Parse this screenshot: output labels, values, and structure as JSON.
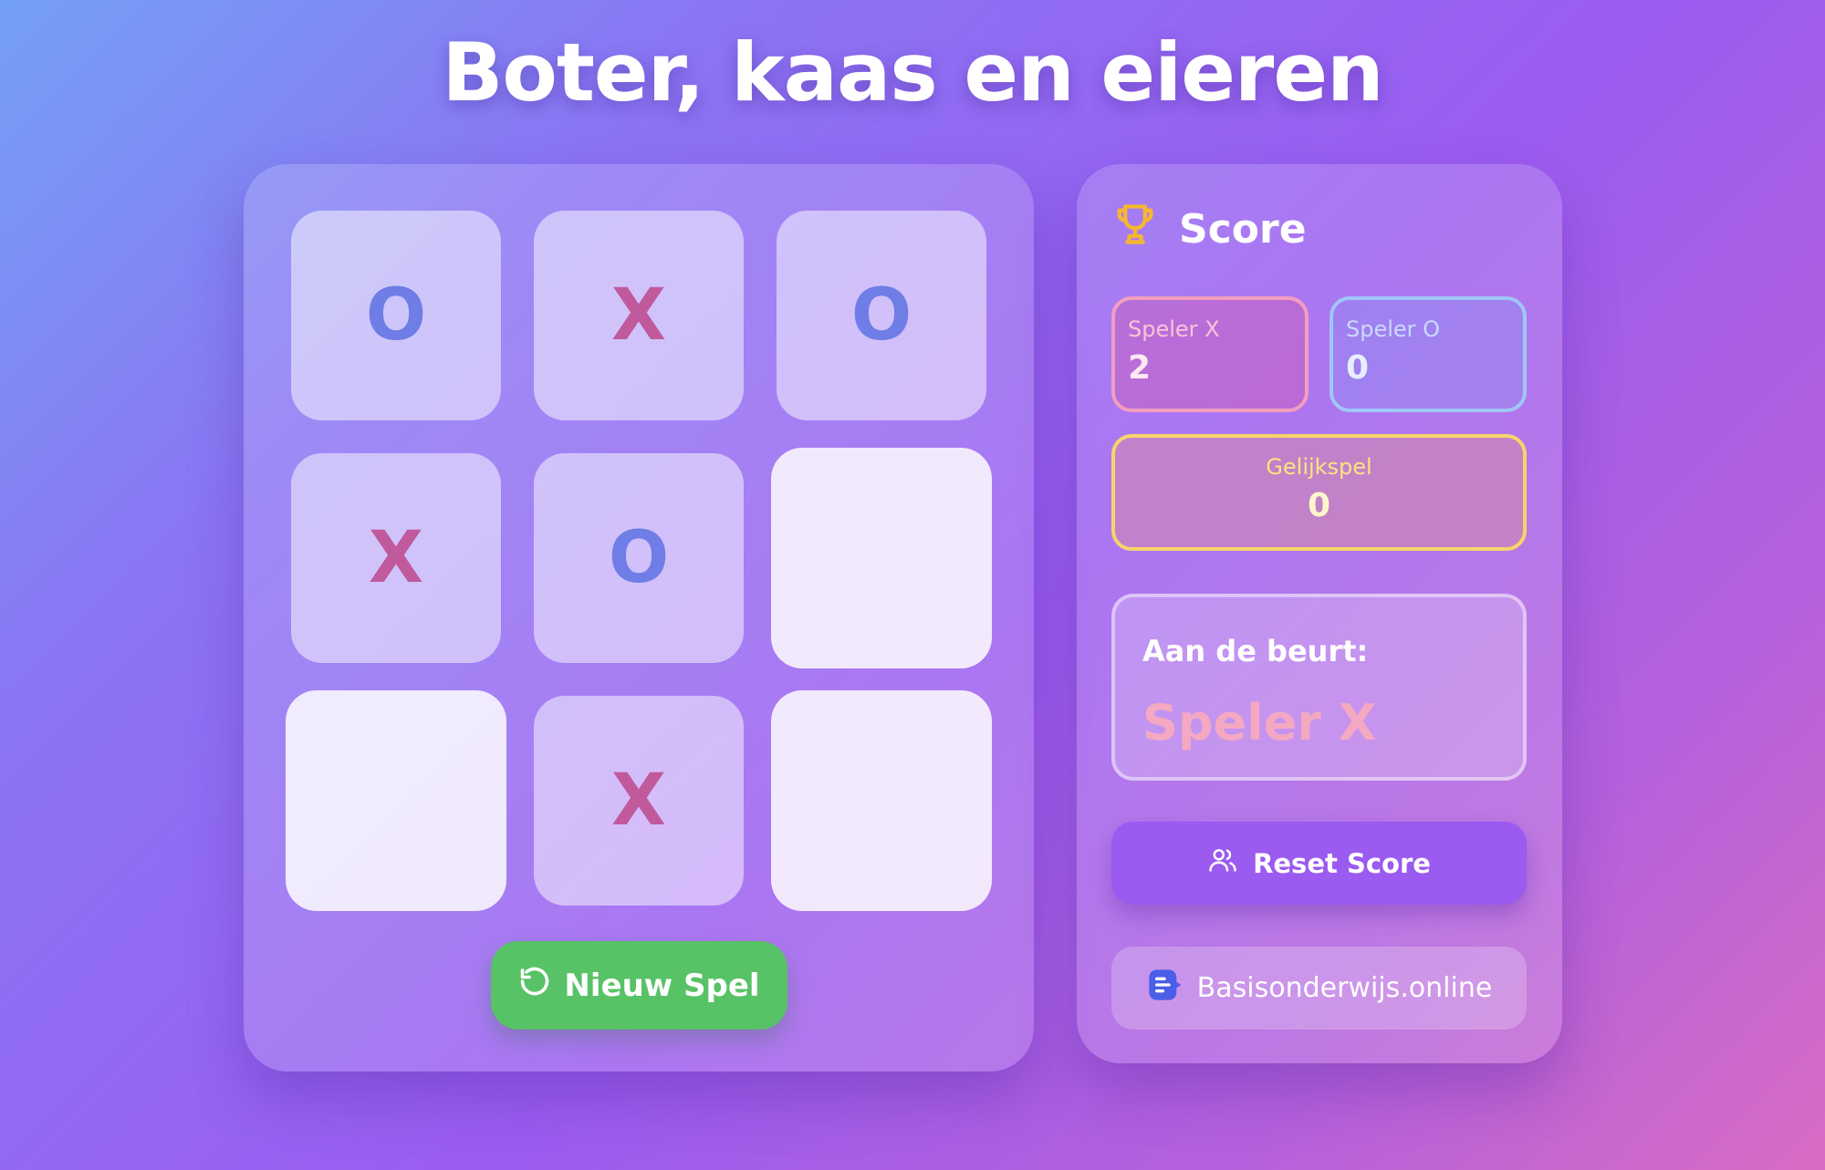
{
  "page": {
    "title": "Boter, kaas en eieren"
  },
  "board": {
    "cells": [
      "O",
      "X",
      "O",
      "X",
      "O",
      "",
      "",
      "X",
      ""
    ],
    "new_game_label": "Nieuw Spel"
  },
  "score": {
    "heading": "Score",
    "player_x": {
      "label": "Speler X",
      "value": "2"
    },
    "player_o": {
      "label": "Speler O",
      "value": "0"
    },
    "draw": {
      "label": "Gelijkspel",
      "value": "0"
    }
  },
  "turn": {
    "label": "Aan de beurt:",
    "player": "Speler X"
  },
  "reset_label": "Reset Score",
  "brand_label": "Basisonderwijs.online",
  "icons": {
    "trophy": "trophy-icon",
    "refresh": "refresh-icon",
    "users": "users-icon",
    "brand": "brand-logo-icon"
  },
  "colors": {
    "x_mark": "#c15a9d",
    "o_mark": "#6f7de6",
    "new_game": "#58c267",
    "reset": "#9b5af0",
    "trophy": "#f5b731"
  }
}
